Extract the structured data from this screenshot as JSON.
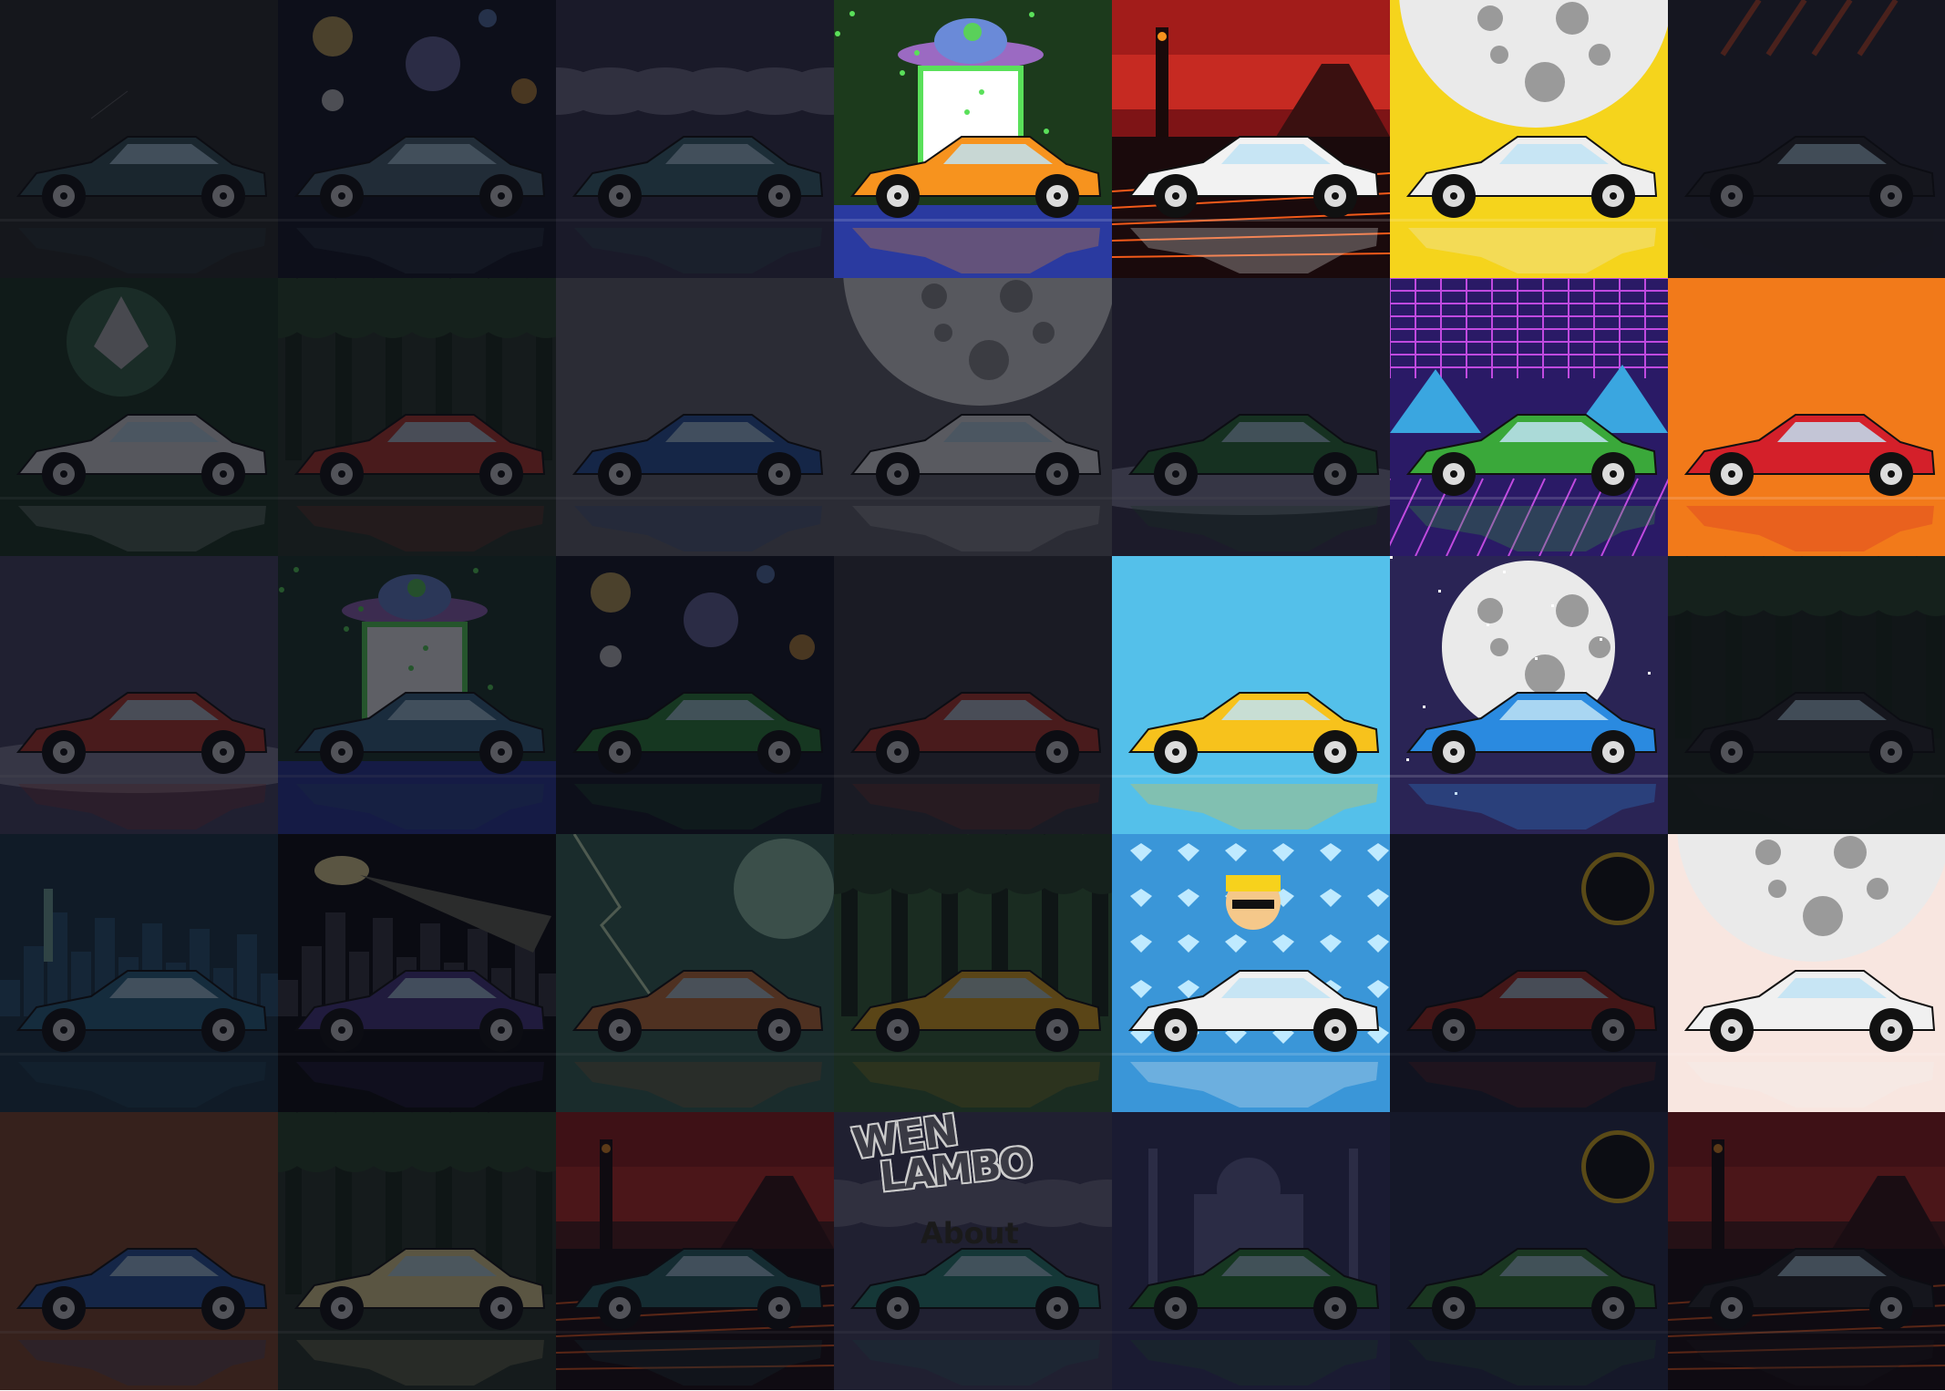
{
  "site": {
    "logo_line1": "WEN",
    "logo_line2": "LAMBO",
    "about_link": "About"
  },
  "gallery": [
    {
      "scene": "stars",
      "bg": "#2a2e2a",
      "car": "#3a5a5e",
      "lit": false
    },
    {
      "scene": "space",
      "bg": "#121624",
      "car": "#4e6a7a",
      "lit": false
    },
    {
      "scene": "clouds",
      "bg": "#3a3650",
      "car": "#3e6e78",
      "lit": false
    },
    {
      "scene": "ufo",
      "bg": "#1c3a1c",
      "car": "#f7931e",
      "lit": true
    },
    {
      "scene": "volcano",
      "bg": "#7e1416",
      "car": "#f2f2f2",
      "lit": true
    },
    {
      "scene": "moon",
      "bg": "#f5d41c",
      "car": "#eeeeee",
      "lit": true
    },
    {
      "scene": "meteor",
      "bg": "#2a2a36",
      "car": "#2a2a2e",
      "lit": false
    },
    {
      "scene": "eth",
      "bg": "#1c3a22",
      "car": "#e6e6e6",
      "lit": false
    },
    {
      "scene": "forest",
      "bg": "#2a3a2a",
      "car": "#c0392b",
      "lit": false
    },
    {
      "scene": "plain",
      "bg": "#6a6a72",
      "car": "#2a5aa8",
      "lit": false
    },
    {
      "scene": "moon",
      "bg": "#6a6a72",
      "car": "#f0f0f0",
      "lit": false
    },
    {
      "scene": "hodl",
      "bg": "#3e3a52",
      "car": "#2e7a3a",
      "lit": false
    },
    {
      "scene": "synth",
      "bg": "#2a1a66",
      "car": "#3aa83a",
      "lit": true
    },
    {
      "scene": "plain",
      "bg": "#f27a1a",
      "car": "#d4202a",
      "lit": true
    },
    {
      "scene": "hodl",
      "bg": "#4a4668",
      "car": "#c0392b",
      "lit": false
    },
    {
      "scene": "ufo",
      "bg": "#1c3a2a",
      "car": "#3a6a8a",
      "lit": false
    },
    {
      "scene": "space",
      "bg": "#121624",
      "car": "#2e8a3a",
      "lit": false
    },
    {
      "scene": "plain",
      "bg": "#3a3a40",
      "car": "#c0392b",
      "lit": false
    },
    {
      "scene": "plain",
      "bg": "#54c0ea",
      "car": "#f7c21c",
      "lit": true
    },
    {
      "scene": "moonbig",
      "bg": "#2a2455",
      "car": "#2a8ae0",
      "lit": true
    },
    {
      "scene": "forest",
      "bg": "#1e2a1e",
      "car": "#2a2a2e",
      "lit": false
    },
    {
      "scene": "city",
      "bg": "#1c3a4a",
      "car": "#2a6a8a",
      "lit": false
    },
    {
      "scene": "bat",
      "bg": "#0a0a0e",
      "car": "#4a3a8a",
      "lit": false
    },
    {
      "scene": "storm",
      "bg": "#3a6a5a",
      "car": "#d27a3a",
      "lit": false
    },
    {
      "scene": "forest",
      "bg": "#3a6a3a",
      "car": "#f2b21c",
      "lit": false
    },
    {
      "scene": "diamonds",
      "bg": "#3a96d8",
      "car": "#f0f0f0",
      "lit": true
    },
    {
      "scene": "eclipse",
      "bg": "#1e2236",
      "car": "#b02a1c",
      "lit": false
    },
    {
      "scene": "moon",
      "bg": "#f8e6e0",
      "car": "#f0f0f0",
      "lit": true
    },
    {
      "scene": "plain",
      "bg": "#8a4a2a",
      "car": "#2a5aa8",
      "lit": false
    },
    {
      "scene": "forest",
      "bg": "#2a3a2a",
      "car": "#f2e29a",
      "lit": false
    },
    {
      "scene": "volcano",
      "bg": "#5a1c1a",
      "car": "#2a6a6a",
      "lit": false
    },
    {
      "scene": "clouds",
      "bg": "#4a4668",
      "car": "#2a8a7a",
      "lit": false
    },
    {
      "scene": "taj",
      "bg": "#3a3a6a",
      "car": "#2e8a3a",
      "lit": false
    },
    {
      "scene": "eclipse",
      "bg": "#2a3050",
      "car": "#3a8a3a",
      "lit": false
    },
    {
      "scene": "volcano",
      "bg": "#5a1c1a",
      "car": "#2a2a2e",
      "lit": false
    }
  ]
}
